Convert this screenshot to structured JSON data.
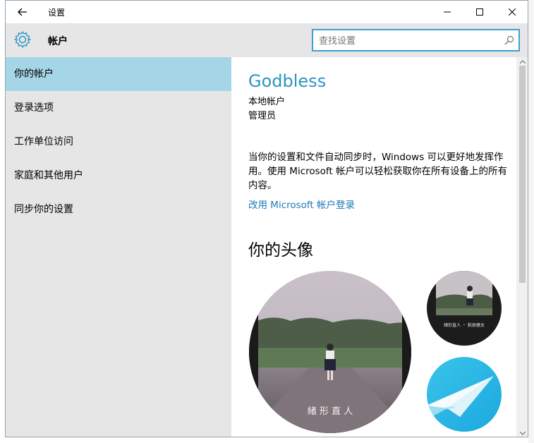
{
  "window": {
    "title": "设置",
    "back_icon": "back-arrow-icon"
  },
  "header": {
    "title": "帐户",
    "icon": "gear-icon"
  },
  "search": {
    "placeholder": "查找设置",
    "icon": "search-icon"
  },
  "sidebar": {
    "items": [
      {
        "label": "你的帐户",
        "selected": true
      },
      {
        "label": "登录选项",
        "selected": false
      },
      {
        "label": "工作单位访问",
        "selected": false
      },
      {
        "label": "家庭和其他用户",
        "selected": false
      },
      {
        "label": "同步你的设置",
        "selected": false
      }
    ]
  },
  "main": {
    "user_name": "Godbless",
    "account_type": "本地帐户",
    "role": "管理员",
    "description": "当你的设置和文件自动同步时，Windows 可以更好地发挥作用。使用 Microsoft 帐户可以轻松获取你在所有设备上的所有内容。",
    "ms_link": "改用 Microsoft 帐户登录",
    "avatar_heading": "你的头像",
    "avatar_caption": "緒 形 直 人",
    "small_avatar_caption": "緒形直人 ・ 萩原健太"
  },
  "colors": {
    "accent": "#2a96c4",
    "selected_nav": "#a5d6e8",
    "sidebar_bg": "#e6e6e6",
    "search_border": "#3d9ed7"
  }
}
